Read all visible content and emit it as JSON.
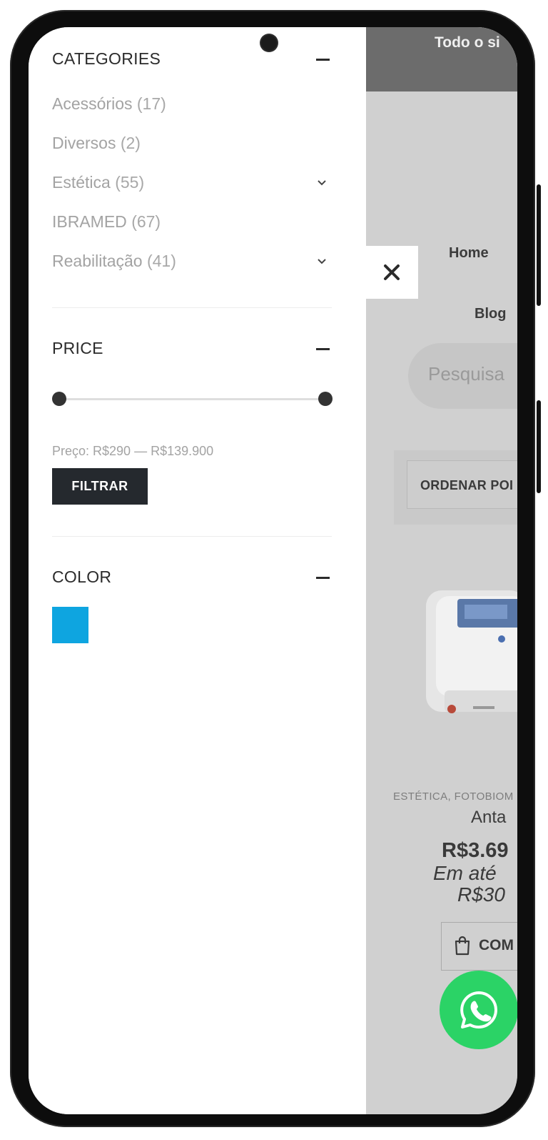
{
  "background_page": {
    "topbar_text": "Todo o si",
    "nav_home": "Home",
    "nav_blog": "Blog",
    "search_placeholder": "Pesquisa",
    "order_label": "ORDENAR POI",
    "product": {
      "categories": "ESTÉTICA, FOTOBIOM",
      "name": "Anta",
      "price": "R$3.69",
      "installment_line1": "Em até",
      "installment_line2": "R$30",
      "buy_label": "COM"
    }
  },
  "drawer": {
    "categories_title": "CATEGORIES",
    "categories": [
      {
        "label": "Acessórios",
        "count": "(17)",
        "expandable": false
      },
      {
        "label": "Diversos",
        "count": "(2)",
        "expandable": false
      },
      {
        "label": "Estética",
        "count": "(55)",
        "expandable": true
      },
      {
        "label": "IBRAMED",
        "count": "(67)",
        "expandable": false
      },
      {
        "label": "Reabilitação",
        "count": "(41)",
        "expandable": true
      }
    ],
    "price_title": "PRICE",
    "price_range": {
      "min": 290,
      "max": 139900
    },
    "price_text": "Preço: R$290 — R$139.900",
    "filter_button": "FILTRAR",
    "color_title": "COLOR",
    "colors": [
      "#0ea5e0"
    ]
  },
  "icons": {
    "close": "close-icon",
    "whatsapp": "whatsapp-icon",
    "bag": "shopping-bag-icon",
    "minus": "minus-icon",
    "chevron": "chevron-down-icon"
  }
}
